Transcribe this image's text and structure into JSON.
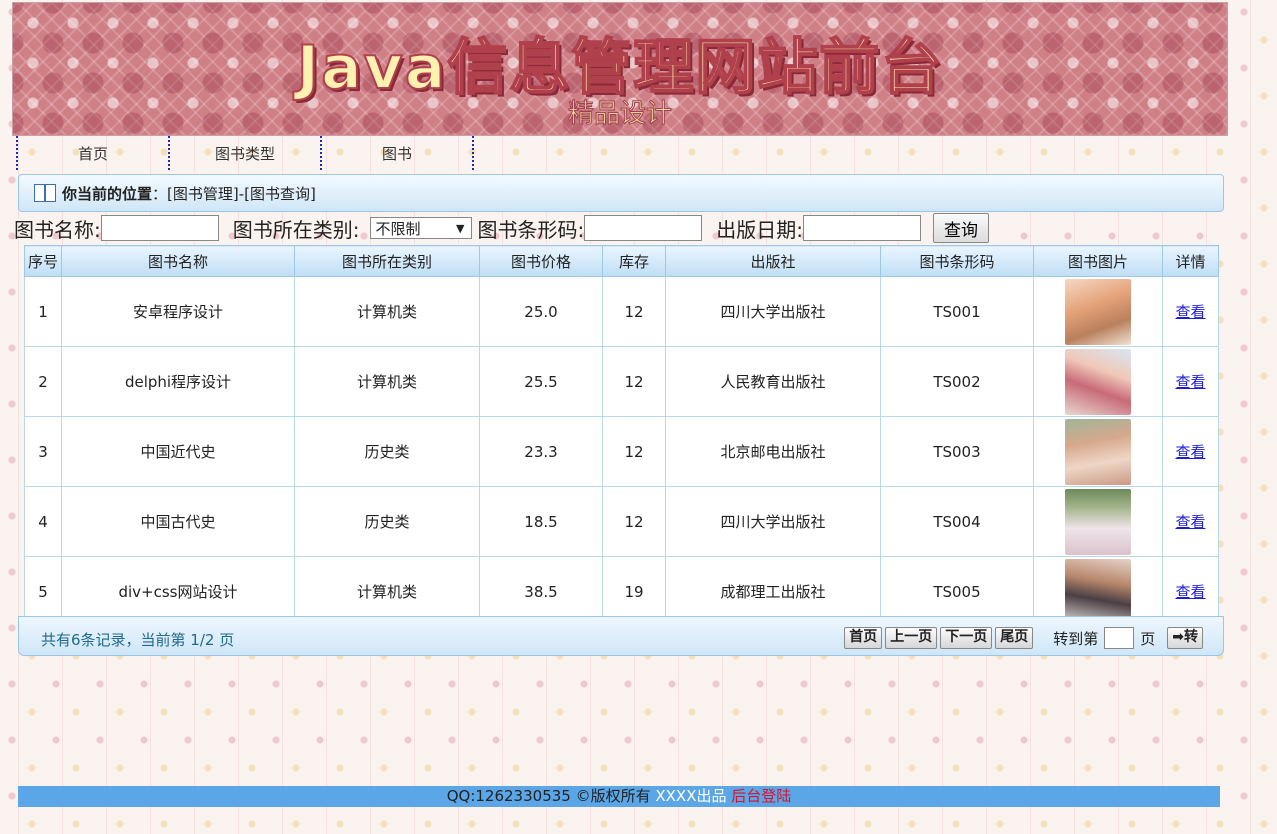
{
  "banner": {
    "title": "Java信息管理网站前台",
    "subtitle": "精品设计"
  },
  "nav": [
    {
      "label": "首页"
    },
    {
      "label": "图书类型"
    },
    {
      "label": "图书"
    }
  ],
  "location": {
    "label": "你当前的位置",
    "sep": "：",
    "path": "[图书管理]-[图书查询]"
  },
  "search": {
    "name_label": "图书名称:",
    "category_label": "图书所在类别:",
    "category_value": "不限制",
    "barcode_label": "图书条形码:",
    "date_label": "出版日期:",
    "query_button": "查询"
  },
  "table": {
    "headers": [
      "序号",
      "图书名称",
      "图书所在类别",
      "图书价格",
      "库存",
      "出版社",
      "图书条形码",
      "图书图片",
      "详情"
    ],
    "rows": [
      {
        "no": "1",
        "name": "安卓程序设计",
        "category": "计算机类",
        "price": "25.0",
        "stock": "12",
        "publisher": "四川大学出版社",
        "barcode": "TS001",
        "detail": "查看"
      },
      {
        "no": "2",
        "name": "delphi程序设计",
        "category": "计算机类",
        "price": "25.5",
        "stock": "12",
        "publisher": "人民教育出版社",
        "barcode": "TS002",
        "detail": "查看"
      },
      {
        "no": "3",
        "name": "中国近代史",
        "category": "历史类",
        "price": "23.3",
        "stock": "12",
        "publisher": "北京邮电出版社",
        "barcode": "TS003",
        "detail": "查看"
      },
      {
        "no": "4",
        "name": "中国古代史",
        "category": "历史类",
        "price": "18.5",
        "stock": "12",
        "publisher": "四川大学出版社",
        "barcode": "TS004",
        "detail": "查看"
      },
      {
        "no": "5",
        "name": "div+css网站设计",
        "category": "计算机类",
        "price": "38.5",
        "stock": "19",
        "publisher": "成都理工出版社",
        "barcode": "TS005",
        "detail": "查看"
      }
    ]
  },
  "pager": {
    "info": "共有6条记录，当前第 1/2 页",
    "first": "首页",
    "prev": "上一页",
    "next": "下一页",
    "last": "尾页",
    "goto_label": "转到第",
    "goto_unit": "页",
    "go": "➡转"
  },
  "footer": {
    "copyright": "QQ:1262330535 ©版权所有",
    "maker": "XXXX出品",
    "admin": "后台登陆"
  },
  "colors": {
    "accent": "#5aa6e6",
    "link": "#1d1dd8",
    "admin_link": "#e0102a",
    "header_bg": "#bfdef5"
  }
}
